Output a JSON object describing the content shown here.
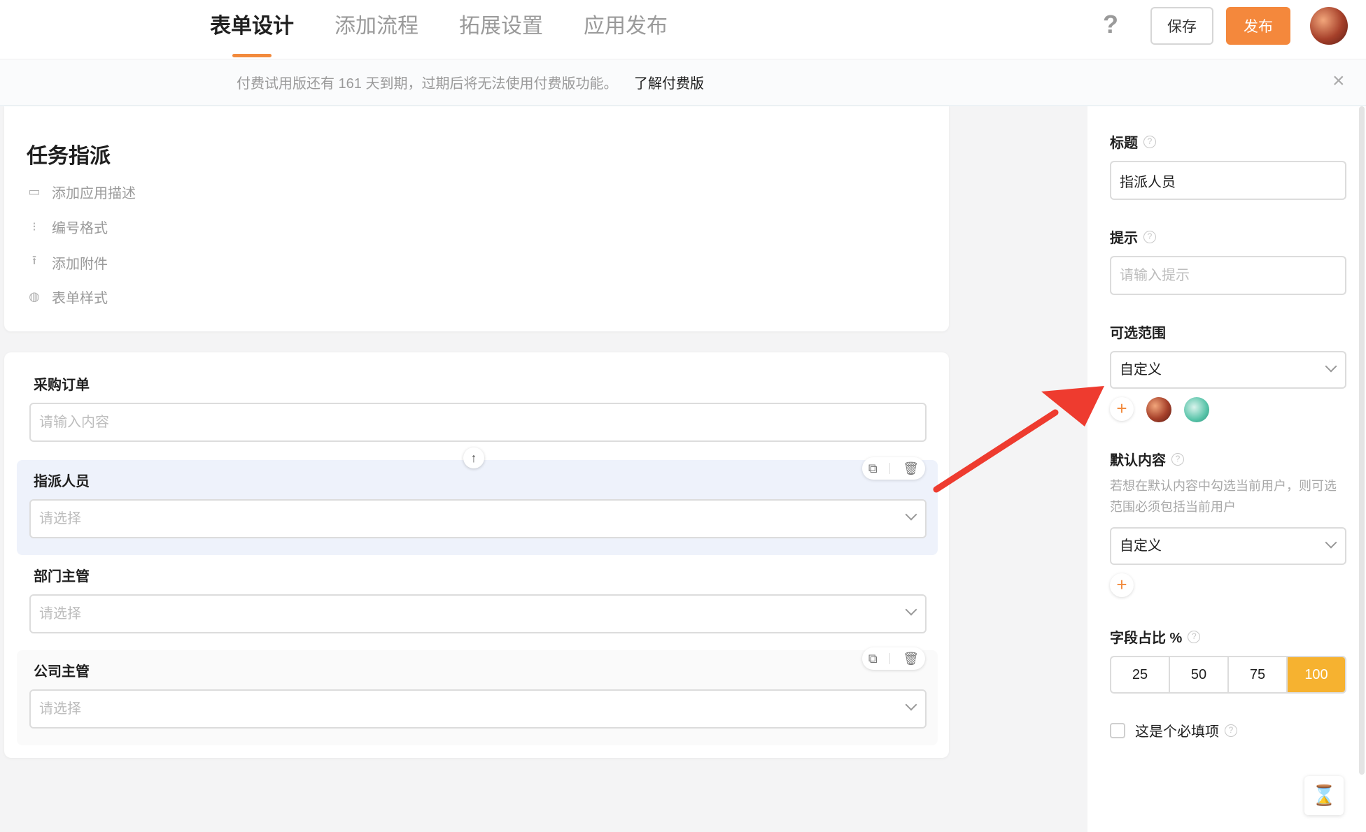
{
  "header": {
    "tabs": [
      {
        "label": "表单设计",
        "active": true
      },
      {
        "label": "添加流程",
        "active": false
      },
      {
        "label": "拓展设置",
        "active": false
      },
      {
        "label": "应用发布",
        "active": false
      }
    ],
    "help_icon": "?",
    "save_label": "保存",
    "publish_label": "发布",
    "accent_color": "#f4883c"
  },
  "notice": {
    "text": "付费试用版还有 161 天到期，过期后将无法使用付费版功能。",
    "link": "了解付费版",
    "close": "×"
  },
  "app_info": {
    "title": "任务指派",
    "options": [
      {
        "icon": "comment-icon",
        "glyph": "▭",
        "label": "添加应用描述"
      },
      {
        "icon": "numbering-icon",
        "glyph": "⁝",
        "label": "编号格式"
      },
      {
        "icon": "upload-icon",
        "glyph": "⭱",
        "label": "添加附件"
      },
      {
        "icon": "palette-icon",
        "glyph": "◍",
        "label": "表单样式"
      }
    ]
  },
  "form": {
    "fields": [
      {
        "label": "采购订单",
        "placeholder": "请输入内容",
        "type": "text",
        "state": "normal"
      },
      {
        "label": "指派人员",
        "placeholder": "请选择",
        "type": "select",
        "state": "selected"
      },
      {
        "label": "部门主管",
        "placeholder": "请选择",
        "type": "select",
        "state": "normal"
      },
      {
        "label": "公司主管",
        "placeholder": "请选择",
        "type": "select",
        "state": "hovered"
      }
    ],
    "copy_icon": "⧉",
    "delete_icon": "🗑",
    "move_up_icon": "↑"
  },
  "panel": {
    "title_label": "标题",
    "title_value": "指派人员",
    "hint_label": "提示",
    "hint_placeholder": "请输入提示",
    "range_label": "可选范围",
    "range_value": "自定义",
    "default_label": "默认内容",
    "default_hint": "若想在默认内容中勾选当前用户，则可选范围必须包括当前用户",
    "default_value": "自定义",
    "ratio_label": "字段占比 %",
    "ratio_options": [
      "25",
      "50",
      "75",
      "100"
    ],
    "ratio_selected": "100",
    "required_label": "这是个必填项",
    "help_mark": "?",
    "plus": "+",
    "hourglass": "⌛"
  }
}
